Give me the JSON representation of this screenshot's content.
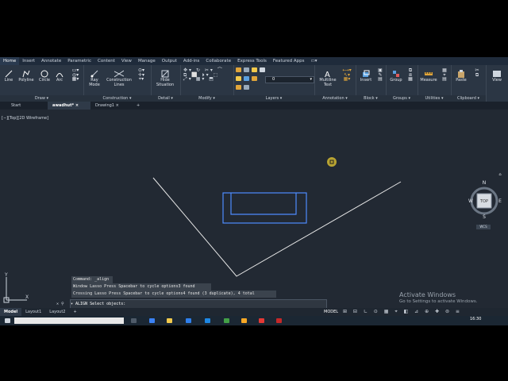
{
  "ribbon_tabs": [
    "Home",
    "Insert",
    "Annotate",
    "Parametric",
    "Content",
    "View",
    "Manage",
    "Output",
    "Add-ins",
    "Collaborate",
    "Express Tools",
    "Featured Apps"
  ],
  "panels": {
    "draw": {
      "title": "Draw",
      "tools": [
        "Line",
        "Polyline",
        "Circle",
        "Arc"
      ]
    },
    "construction": {
      "title": "Construction",
      "tools": [
        "Ray Mode",
        "Construction Lines"
      ]
    },
    "detail": {
      "title": "Detail",
      "tools": [
        "Hide Situation"
      ]
    },
    "modify": {
      "title": "Modify"
    },
    "layers": {
      "title": "Layers",
      "layer_value": "0"
    },
    "annotation": {
      "title": "Annotation",
      "tools": [
        "Multiline Text"
      ]
    },
    "block": {
      "title": "Block",
      "tools": [
        "Insert"
      ]
    },
    "groups": {
      "title": "Groups",
      "tools": [
        "Group"
      ]
    },
    "utilities": {
      "title": "Utilities",
      "tools": [
        "Measure"
      ]
    },
    "clipboard": {
      "title": "Clipboard",
      "tools": [
        "Paste"
      ]
    },
    "view": {
      "tools": [
        "View"
      ]
    }
  },
  "doc_tabs": [
    "Start",
    "awadhut*",
    "Drawing1"
  ],
  "viewport_label": "[−][Top][2D Wireframe]",
  "viewcube": {
    "top": "TOP",
    "north": "N",
    "south": "S",
    "east": "E",
    "west": "W",
    "wcs": "WCS"
  },
  "command_history": [
    "Command: _align",
    "Window Lasso  Press Spacebar to cycle options3 found",
    "Crossing Lasso  Press Spacebar to cycle options4 found (3 duplicate), 4 total"
  ],
  "command_prompt": "▾ ALIGN Select objects:",
  "status_tabs": [
    "Model",
    "Layout1",
    "Layout2"
  ],
  "status_model": "MODEL",
  "watermark": {
    "line1": "Activate Windows",
    "line2": "Go to Settings to activate Windows."
  },
  "taskbar_time": "16:30",
  "colors": {
    "canvas": "#222933",
    "ribbon": "#2b3644",
    "geometry": "#ffffff",
    "selection": "#4e8cff",
    "accent_tab": "#2a3a4f"
  }
}
